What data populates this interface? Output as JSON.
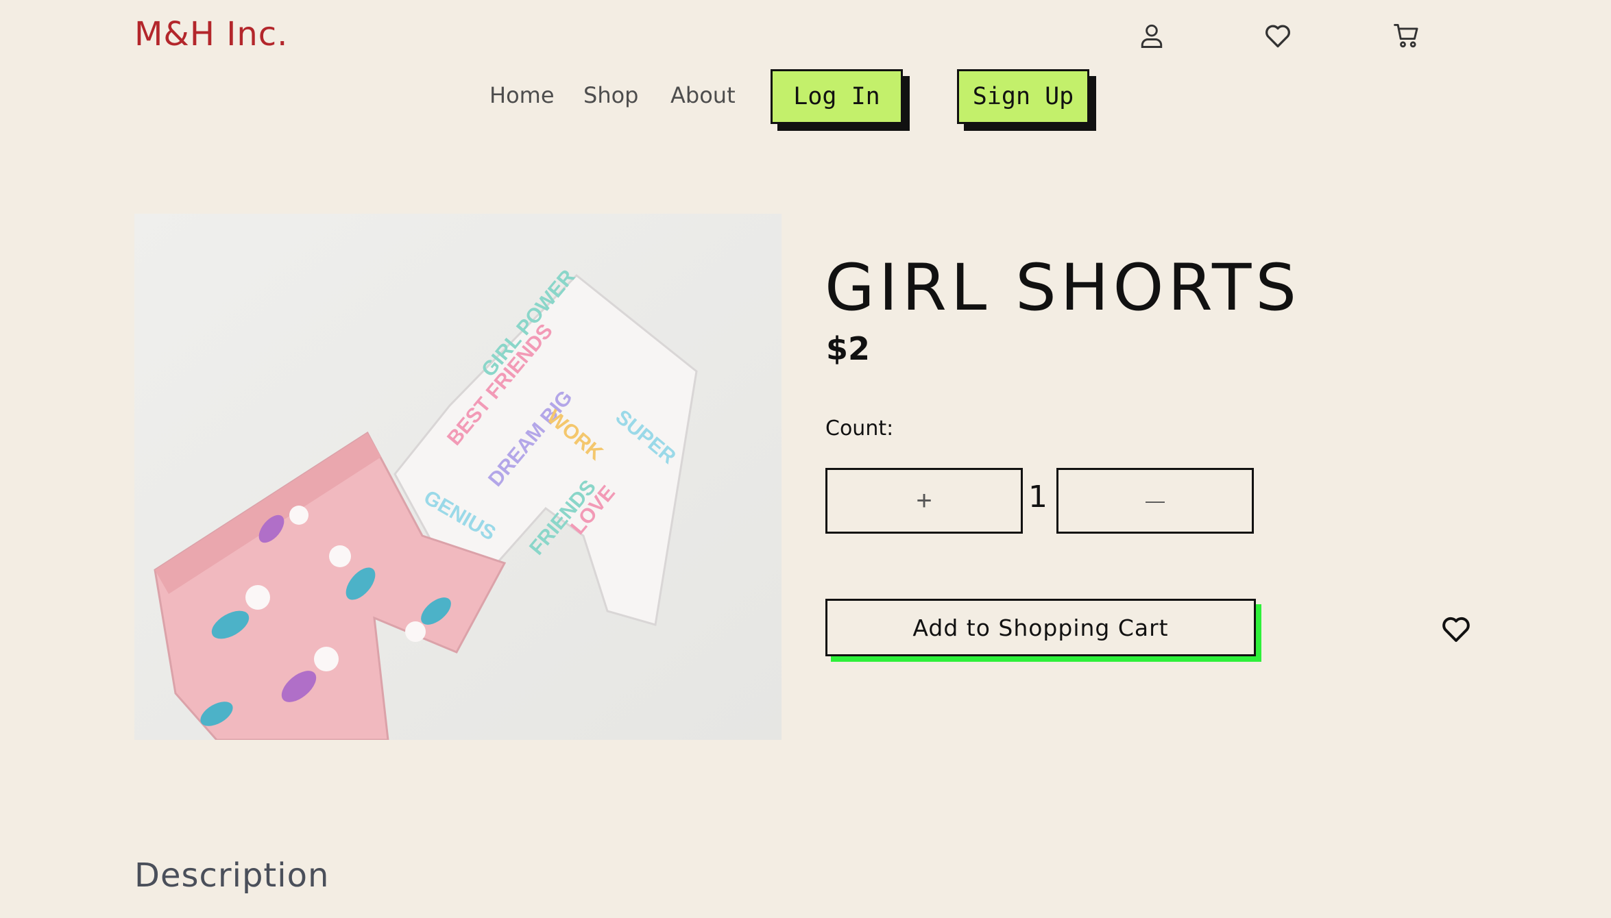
{
  "brand": "M&H Inc.",
  "header_icons": [
    "user-icon",
    "heart-icon",
    "cart-icon"
  ],
  "nav": {
    "home": "Home",
    "shop": "Shop",
    "about": "About",
    "login": "Log In",
    "signup": "Sign Up"
  },
  "product": {
    "title": "GIRL SHORTS",
    "price": "$2",
    "count_label": "Count:",
    "increment_label": "+",
    "quantity": "1",
    "decrement_label": "—",
    "add_to_cart": "Add to Shopping Cart",
    "wishlist_icon": "heart-icon"
  },
  "description_heading": "Description",
  "colors": {
    "background": "#f3ede3",
    "brand": "#b3262b",
    "cta_fill": "#c3f06b",
    "add_cart_shadow": "#2ef03a"
  }
}
